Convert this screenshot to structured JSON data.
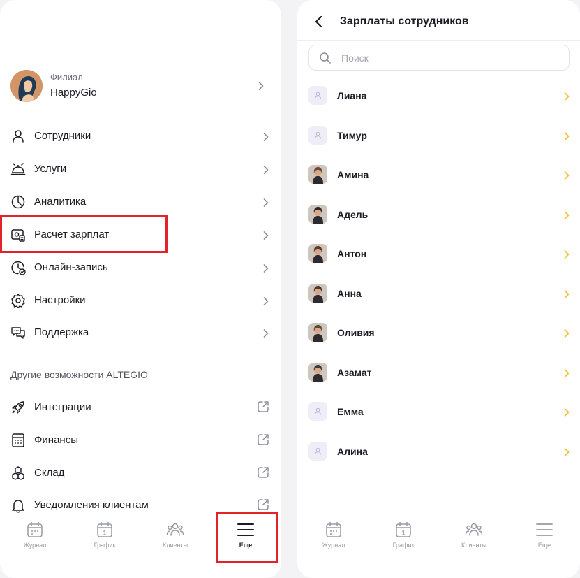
{
  "left": {
    "branch": {
      "caption": "Филиал",
      "name": "HappyGio"
    },
    "menu": [
      {
        "id": "employees",
        "label": "Сотрудники",
        "icon": "person-icon"
      },
      {
        "id": "services",
        "label": "Услуги",
        "icon": "cloche-icon"
      },
      {
        "id": "analytics",
        "label": "Аналитика",
        "icon": "pie-chart-icon"
      },
      {
        "id": "payroll",
        "label": "Расчет зарплат",
        "icon": "cash-register-icon"
      },
      {
        "id": "online-booking",
        "label": "Онлайн-запись",
        "icon": "clock-check-icon"
      },
      {
        "id": "settings",
        "label": "Настройки",
        "icon": "gear-icon"
      },
      {
        "id": "support",
        "label": "Поддержка",
        "icon": "chat-bubbles-icon"
      }
    ],
    "section_title": "Другие возможности ALTEGIO",
    "other": [
      {
        "id": "integrations",
        "label": "Интеграции",
        "icon": "rocket-icon"
      },
      {
        "id": "finance",
        "label": "Финансы",
        "icon": "calculator-icon"
      },
      {
        "id": "warehouse",
        "label": "Склад",
        "icon": "boxes-icon"
      },
      {
        "id": "client-notifications",
        "label": "Уведомления клиентам",
        "icon": "bell-icon"
      }
    ],
    "nav": [
      {
        "label": "Журнал",
        "icon": "calendar-icon",
        "active": false
      },
      {
        "label": "График",
        "icon": "calendar-day-icon",
        "active": false
      },
      {
        "label": "Клиенты",
        "icon": "people-icon",
        "active": false
      },
      {
        "label": "Еще",
        "icon": "menu-icon",
        "active": true
      }
    ]
  },
  "right": {
    "title": "Зарплаты сотрудников",
    "search_placeholder": "Поиск",
    "employees": [
      {
        "name": "Лиана",
        "photo": false
      },
      {
        "name": "Тимур",
        "photo": false
      },
      {
        "name": "Амина",
        "photo": true
      },
      {
        "name": "Адель",
        "photo": true
      },
      {
        "name": "Антон",
        "photo": true
      },
      {
        "name": "Анна",
        "photo": true
      },
      {
        "name": "Оливия",
        "photo": true
      },
      {
        "name": "Азамат",
        "photo": true
      },
      {
        "name": "Емма",
        "photo": false
      },
      {
        "name": "Алина",
        "photo": false
      }
    ],
    "nav": [
      {
        "label": "Журнал",
        "icon": "calendar-icon",
        "active": false
      },
      {
        "label": "График",
        "icon": "calendar-day-icon",
        "active": false
      },
      {
        "label": "Клиенты",
        "icon": "people-icon",
        "active": false
      },
      {
        "label": "Еще",
        "icon": "menu-icon",
        "active": false
      }
    ]
  },
  "colors": {
    "highlight": "#e3232a",
    "chevron_accent": "#f2c12e",
    "chevron_muted": "#8e8e99",
    "text": "#1c1c24"
  }
}
